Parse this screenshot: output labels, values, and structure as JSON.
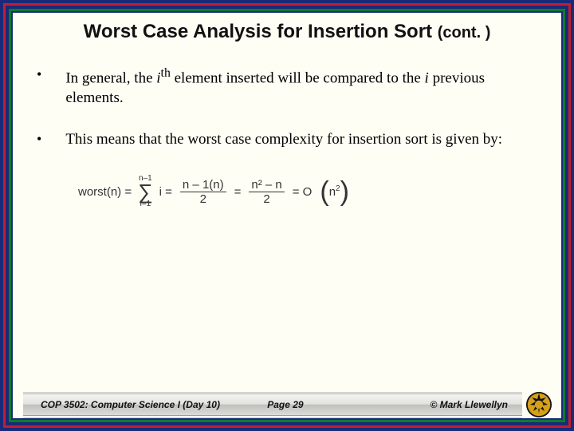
{
  "title": {
    "main": "Worst Case Analysis for Insertion Sort",
    "cont": "(cont. )"
  },
  "bullets": [
    {
      "pre": "In general, the ",
      "ith_i": "i",
      "ith_th": "th",
      "mid": " element inserted will be compared to the ",
      "ivar": "i",
      "post": " previous elements."
    },
    {
      "text": "This means that the worst case complexity for insertion sort is given by:"
    }
  ],
  "formula": {
    "lhs": "worst(n) =",
    "sigma_top": "n–1",
    "sigma_bottom": "i=1",
    "sum_var": "i =",
    "frac1_num": "n – 1(n)",
    "frac1_den": "2",
    "eq1": "=",
    "frac2_num": "n² – n",
    "frac2_den": "2",
    "eq2": "= O",
    "bigO_inner": "n",
    "bigO_sup": "2"
  },
  "footer": {
    "course": "COP 3502: Computer Science I  (Day 10)",
    "page": "Page 29",
    "copyright": "© Mark Llewellyn"
  }
}
